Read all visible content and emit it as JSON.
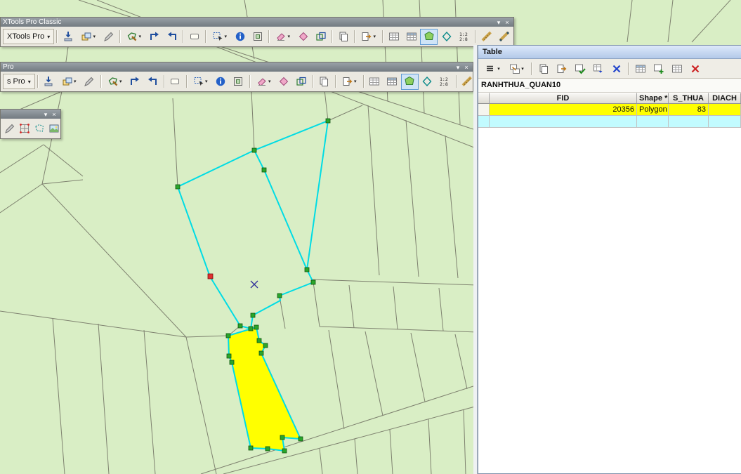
{
  "ui": {
    "caret": "▾",
    "close": "×"
  },
  "colors": {
    "map_background": "#d9eec5",
    "parcel_line": "#7e816f",
    "sketch_line": "#00dce4",
    "vertex_fill": "#2aa62a",
    "active_vertex_fill": "#e03030",
    "selected_parcel_fill": "#ffff00",
    "row_highlight_yellow": "#ffff00",
    "row_highlight_cyan": "#c2fbff"
  },
  "xtools_toolbar": {
    "classic_title": "XTools Pro Classic",
    "classic_menu_label": "XTools Pro",
    "docked_title": "Pro",
    "docked_menu_label": "s Pro",
    "icon_names": [
      "apply-edits",
      "copy-features",
      "edit-sketch",
      "edit-polygon",
      "trace-forward",
      "trace-backward",
      "label-tag",
      "select-features",
      "identify",
      "extent-frame",
      "eraser",
      "erase-shape",
      "merge-shapes",
      "copy-sheet",
      "export-data",
      "attribute-table",
      "attribute-table-styled",
      "select-polygon-active",
      "diamond-tool",
      "coordinate-readout",
      "measure",
      "measure-segments",
      "send-mail"
    ]
  },
  "mini_toolbar": {
    "icon_names": [
      "sketch-pencil",
      "adjust-grid",
      "dashed-polygon",
      "raster-image"
    ]
  },
  "table_panel": {
    "title": "Table",
    "toolbar_icon_names": [
      "table-options",
      "related-tables",
      "copy-rows",
      "paste-rows",
      "find-replace",
      "select-switch",
      "clear-selection",
      "zoom-to-selected",
      "add-rows",
      "table-export",
      "delete-selected"
    ],
    "layer_name": "RANHTHUA_QUAN10",
    "columns": [
      "FID",
      "Shape *",
      "S_THUA",
      "DIACH"
    ],
    "rows": [
      {
        "fid": "20356",
        "shape": "Polygon",
        "s_thua": "83",
        "diach": "",
        "highlight": "yellow"
      },
      {
        "fid": "",
        "shape": "",
        "s_thua": "",
        "diach": "",
        "highlight": "cyan"
      }
    ]
  }
}
